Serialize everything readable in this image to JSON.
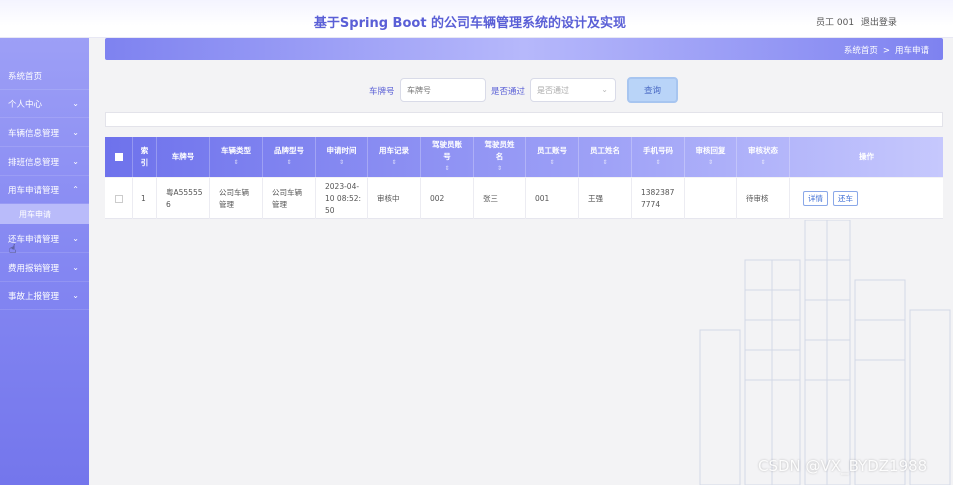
{
  "header": {
    "title": "基于Spring Boot 的公司车辆管理系统的设计及实现",
    "user_label": "员工 001",
    "logout_label": "退出登录"
  },
  "sidebar": {
    "items": [
      {
        "label": "系统首页",
        "chevron": ""
      },
      {
        "label": "个人中心",
        "chevron": "⌄"
      },
      {
        "label": "车辆信息管理",
        "chevron": "⌄"
      },
      {
        "label": "排班信息管理",
        "chevron": "⌄"
      },
      {
        "label": "用车申请管理",
        "chevron": "⌃"
      },
      {
        "label": "还车申请管理",
        "chevron": "⌄"
      },
      {
        "label": "费用报销管理",
        "chevron": "⌄"
      },
      {
        "label": "事故上报管理",
        "chevron": "⌄"
      }
    ],
    "sub_item": "用车申请"
  },
  "breadcrumb": {
    "home": "系统首页",
    "separator": ">",
    "current": "用车申请"
  },
  "search": {
    "plate_label": "车牌号",
    "plate_placeholder": "车牌号",
    "pass_label": "是否通过",
    "pass_placeholder": "是否通过",
    "query_button": "查询"
  },
  "table": {
    "columns": [
      {
        "label": "索\n引",
        "sort": ""
      },
      {
        "label": "车牌号",
        "sort": ""
      },
      {
        "label": "车辆类型",
        "sort": "⇕"
      },
      {
        "label": "品牌型号",
        "sort": "⇕"
      },
      {
        "label": "申请时间",
        "sort": "⇕"
      },
      {
        "label": "用车记录",
        "sort": "⇕"
      },
      {
        "label": "驾驶员账\n号",
        "sort": "⇕"
      },
      {
        "label": "驾驶员姓\n名",
        "sort": "⇕"
      },
      {
        "label": "员工账号",
        "sort": "⇕"
      },
      {
        "label": "员工姓名",
        "sort": "⇕"
      },
      {
        "label": "手机号码",
        "sort": "⇕"
      },
      {
        "label": "审核回复",
        "sort": "⇕"
      },
      {
        "label": "审核状态",
        "sort": "⇕"
      },
      {
        "label": "操作",
        "sort": ""
      }
    ],
    "rows": [
      {
        "index": "1",
        "plate": "粤A55555\n6",
        "type": "公司车辆\n管理",
        "brand": "公司车辆\n管理",
        "time": "2023-04-\n10 08:52:\n50",
        "record": "审核中",
        "driver_account": "002",
        "driver_name": "张三",
        "staff_account": "001",
        "staff_name": "王强",
        "phone": "1382387\n7774",
        "reply": "",
        "status": "待审核",
        "detail_btn": "详情",
        "return_btn": "还车"
      }
    ]
  },
  "watermark": "CSDN @VX_BYDZ1988"
}
